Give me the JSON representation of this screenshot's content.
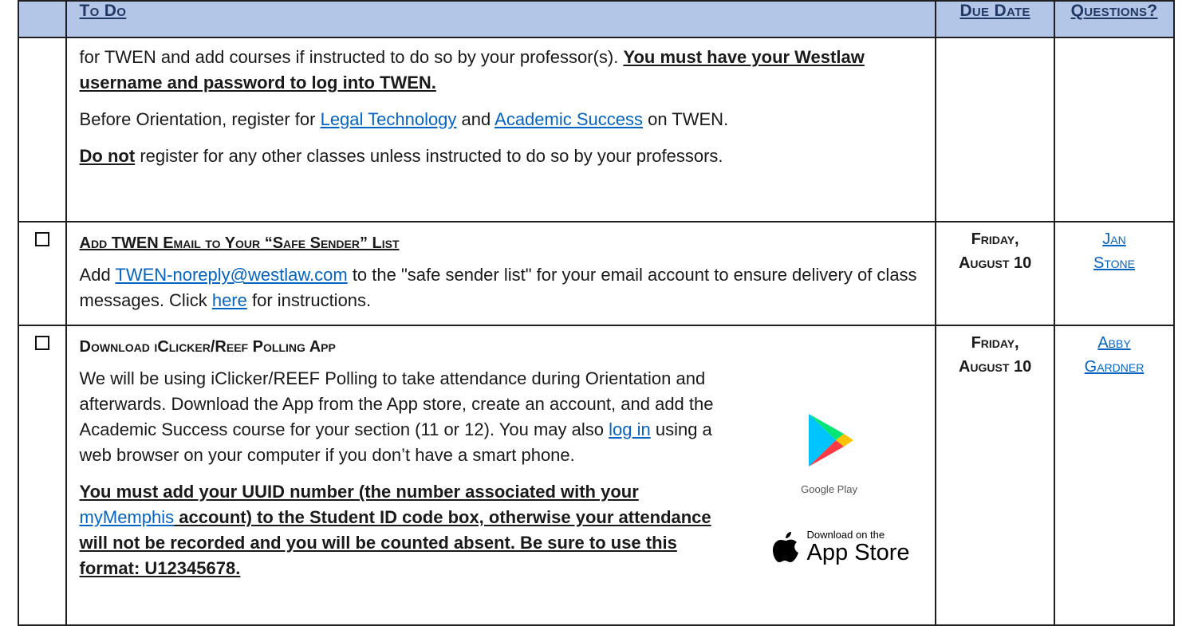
{
  "header": {
    "todo": "To Do",
    "due_date": "Due Date",
    "questions": "Questions?"
  },
  "row1": {
    "line1_text": "for TWEN and add courses if instructed to do so by your professor(s).  ",
    "line1_bold": "You must have your Westlaw username and password to log into TWEN.",
    "p2_pre": "Before Orientation, register for ",
    "p2_link1": "Legal Technology",
    "p2_mid": " and ",
    "p2_link2": "Academic Success",
    "p2_post": " on TWEN.",
    "p3_bold": "Do not",
    "p3_rest": " register for any other classes unless instructed to do so by your professors."
  },
  "row2": {
    "heading": "Add TWEN Email to Your “Safe Sender” List",
    "p_pre": "Add ",
    "p_link": "TWEN-noreply@westlaw.com",
    "p_mid": " to the \"safe sender list\" for your email account to ensure delivery of class messages.  Click ",
    "p_link2": "here",
    "p_post": " for instructions.",
    "due_line1": "Friday,",
    "due_line2": "August 10",
    "contact_line1": "Jan",
    "contact_line2": "Stone"
  },
  "row3": {
    "heading": "Download iClicker/Reef Polling App",
    "p1_pre": "We will be using iClicker/REEF Polling to take attendance during Orientation and afterwards.  Download the App from the App store, create an account, and add the Academic Success course for your section (11 or 12).  You may also ",
    "p1_link": "log in",
    "p1_post": " using a web browser on your computer if you don’t have a smart phone.",
    "p2_pre": "You must add your UUID number (the number associated with your ",
    "p2_link": "myMemphis",
    "p2_post": " account) to the Student ID code box, otherwise your attendance will not be recorded and you will be counted absent.  Be sure to use this format:  U12345678.",
    "gplay_label": "Google Play",
    "appstore_small": "Download on the",
    "appstore_big": "App Store",
    "due_line1": "Friday,",
    "due_line2": "August 10",
    "contact_line1": "Abby",
    "contact_line2": "Gardner"
  }
}
